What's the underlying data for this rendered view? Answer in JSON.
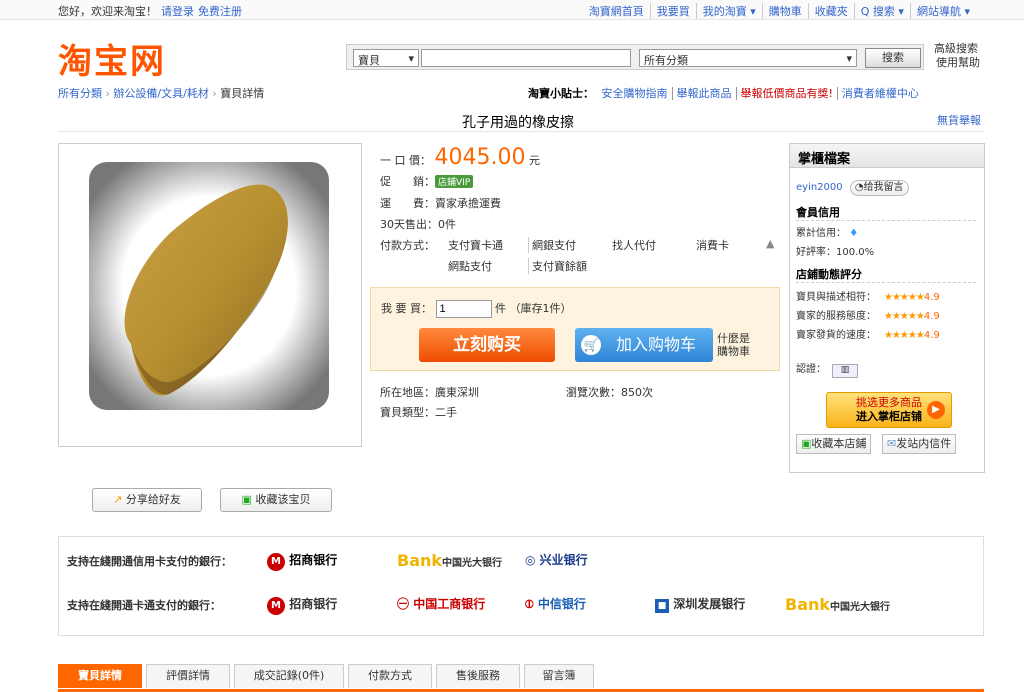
{
  "topbar": {
    "greeting": "您好，欢迎来淘宝！",
    "login": "请登录",
    "register": "免费注册",
    "nav": [
      "淘寶網首頁",
      "我要買",
      "我的淘寶 ▾",
      "購物車",
      "收藏夾",
      "Q 搜索 ▾",
      "網站導航 ▾"
    ]
  },
  "logo": "淘宝网",
  "search": {
    "type": "寶貝",
    "category": "所有分類",
    "button": "搜索",
    "advanced": "高級搜索",
    "help": "使用幫助"
  },
  "breadcrumb": {
    "root": "所有分類",
    "cat": "辦公設備/文具/耗材",
    "current": "寶貝詳情"
  },
  "tips": {
    "label": "淘寶小貼士：",
    "items": [
      "安全購物指南",
      "舉報此商品",
      "舉報低價商品有獎!",
      "消費者維權中心"
    ]
  },
  "item": {
    "title": "孔子用過的橡皮擦",
    "report": "無貨舉報",
    "price_label": "一 口 價：",
    "price": "4045.00",
    "currency": "元",
    "promo_label": "促　　銷：",
    "promo_badge": "店鋪VIP",
    "shipping_label": "運　　費：",
    "shipping": "賣家承擔運費",
    "sold_label": "30天售出：",
    "sold": "0件",
    "pay_label": "付款方式：",
    "pay_methods": [
      "支付寶卡通",
      "網銀支付",
      "找人代付",
      "消費卡",
      "網點支付",
      "支付寶餘額"
    ],
    "buy_label": "我 要 買：",
    "qty": "1",
    "stock": "件 （庫存1件）",
    "buy_now": "立刻购买",
    "add_cart": "加入购物车",
    "what_cart_1": "什麼是",
    "what_cart_2": "購物車",
    "location_label": "所在地區：",
    "location": "廣東深圳",
    "views_label": "瀏覽次數：",
    "views": "850次",
    "type_label": "寶貝類型：",
    "type": "二手"
  },
  "seller": {
    "header": "掌櫃檔案",
    "name": "eyin2000",
    "msg_btn": "给我留言",
    "credit_title": "會員信用",
    "credit_label": "累計信用：",
    "rate_label": "好評率：",
    "rate": "100.0%",
    "dyn_title": "店鋪動態評分",
    "scores": [
      {
        "label": "寶貝與描述相符：",
        "stars": "★★★★★",
        "score": "4.9"
      },
      {
        "label": "賣家的服務態度：",
        "stars": "★★★★★",
        "score": "4.9"
      },
      {
        "label": "賣家發貨的速度：",
        "stars": "★★★★★",
        "score": "4.9"
      }
    ],
    "cert_label": "認證：",
    "enter_1": "挑选更多商品",
    "enter_2": "进入掌柜店铺",
    "fav_shop": "收藏本店鋪",
    "site_msg": "发站内信件"
  },
  "share": "分享给好友",
  "fav": "收藏该宝贝",
  "banks": {
    "credit_label": "支持在綫開通信用卡支付的銀行：",
    "card_label": "支持在綫開通卡通支付的銀行：",
    "credit_banks": [
      "招商银行",
      "中国光大银行",
      "兴业银行"
    ],
    "card_banks": [
      "招商银行",
      "中国工商银行",
      "中信银行",
      "深圳发展银行",
      "中国光大银行"
    ]
  },
  "tabs": [
    "寶貝詳情",
    "評價詳情",
    "成交記錄(0件)",
    "付款方式",
    "售後服務",
    "留言簿"
  ],
  "colors": {
    "accent": "#ff6600",
    "link": "#3366cc"
  }
}
